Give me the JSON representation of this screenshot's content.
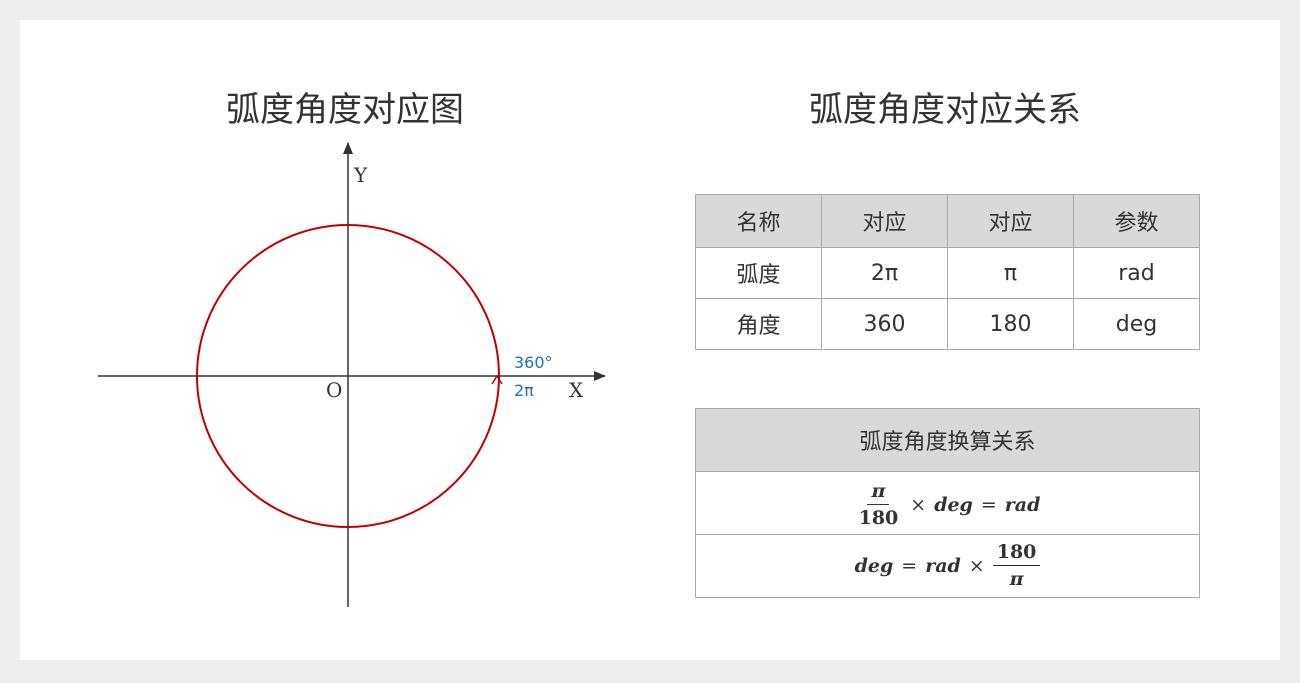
{
  "left": {
    "title": "弧度角度对应图",
    "axis_y": "Y",
    "axis_x": "X",
    "origin": "O",
    "mark_deg": "360°",
    "mark_rad": "2π",
    "colors": {
      "circle": "#c00000",
      "marker": "#1f6fbf",
      "axis": "#333333"
    }
  },
  "right": {
    "title": "弧度角度对应关系",
    "corr_table": {
      "headers": [
        "名称",
        "对应",
        "对应",
        "参数"
      ],
      "rows": [
        [
          "弧度",
          "2π",
          "π",
          "rad"
        ],
        [
          "角度",
          "360",
          "180",
          "deg"
        ]
      ]
    },
    "conv_table": {
      "header": "弧度角度换算关系",
      "f1": {
        "num": "π",
        "den": "180",
        "times": "×",
        "deg": "deg",
        "eq": "=",
        "rad": "rad"
      },
      "f2": {
        "deg": "deg",
        "eq": "=",
        "rad": "rad",
        "times": "×",
        "num": "180",
        "den": "π"
      }
    }
  }
}
